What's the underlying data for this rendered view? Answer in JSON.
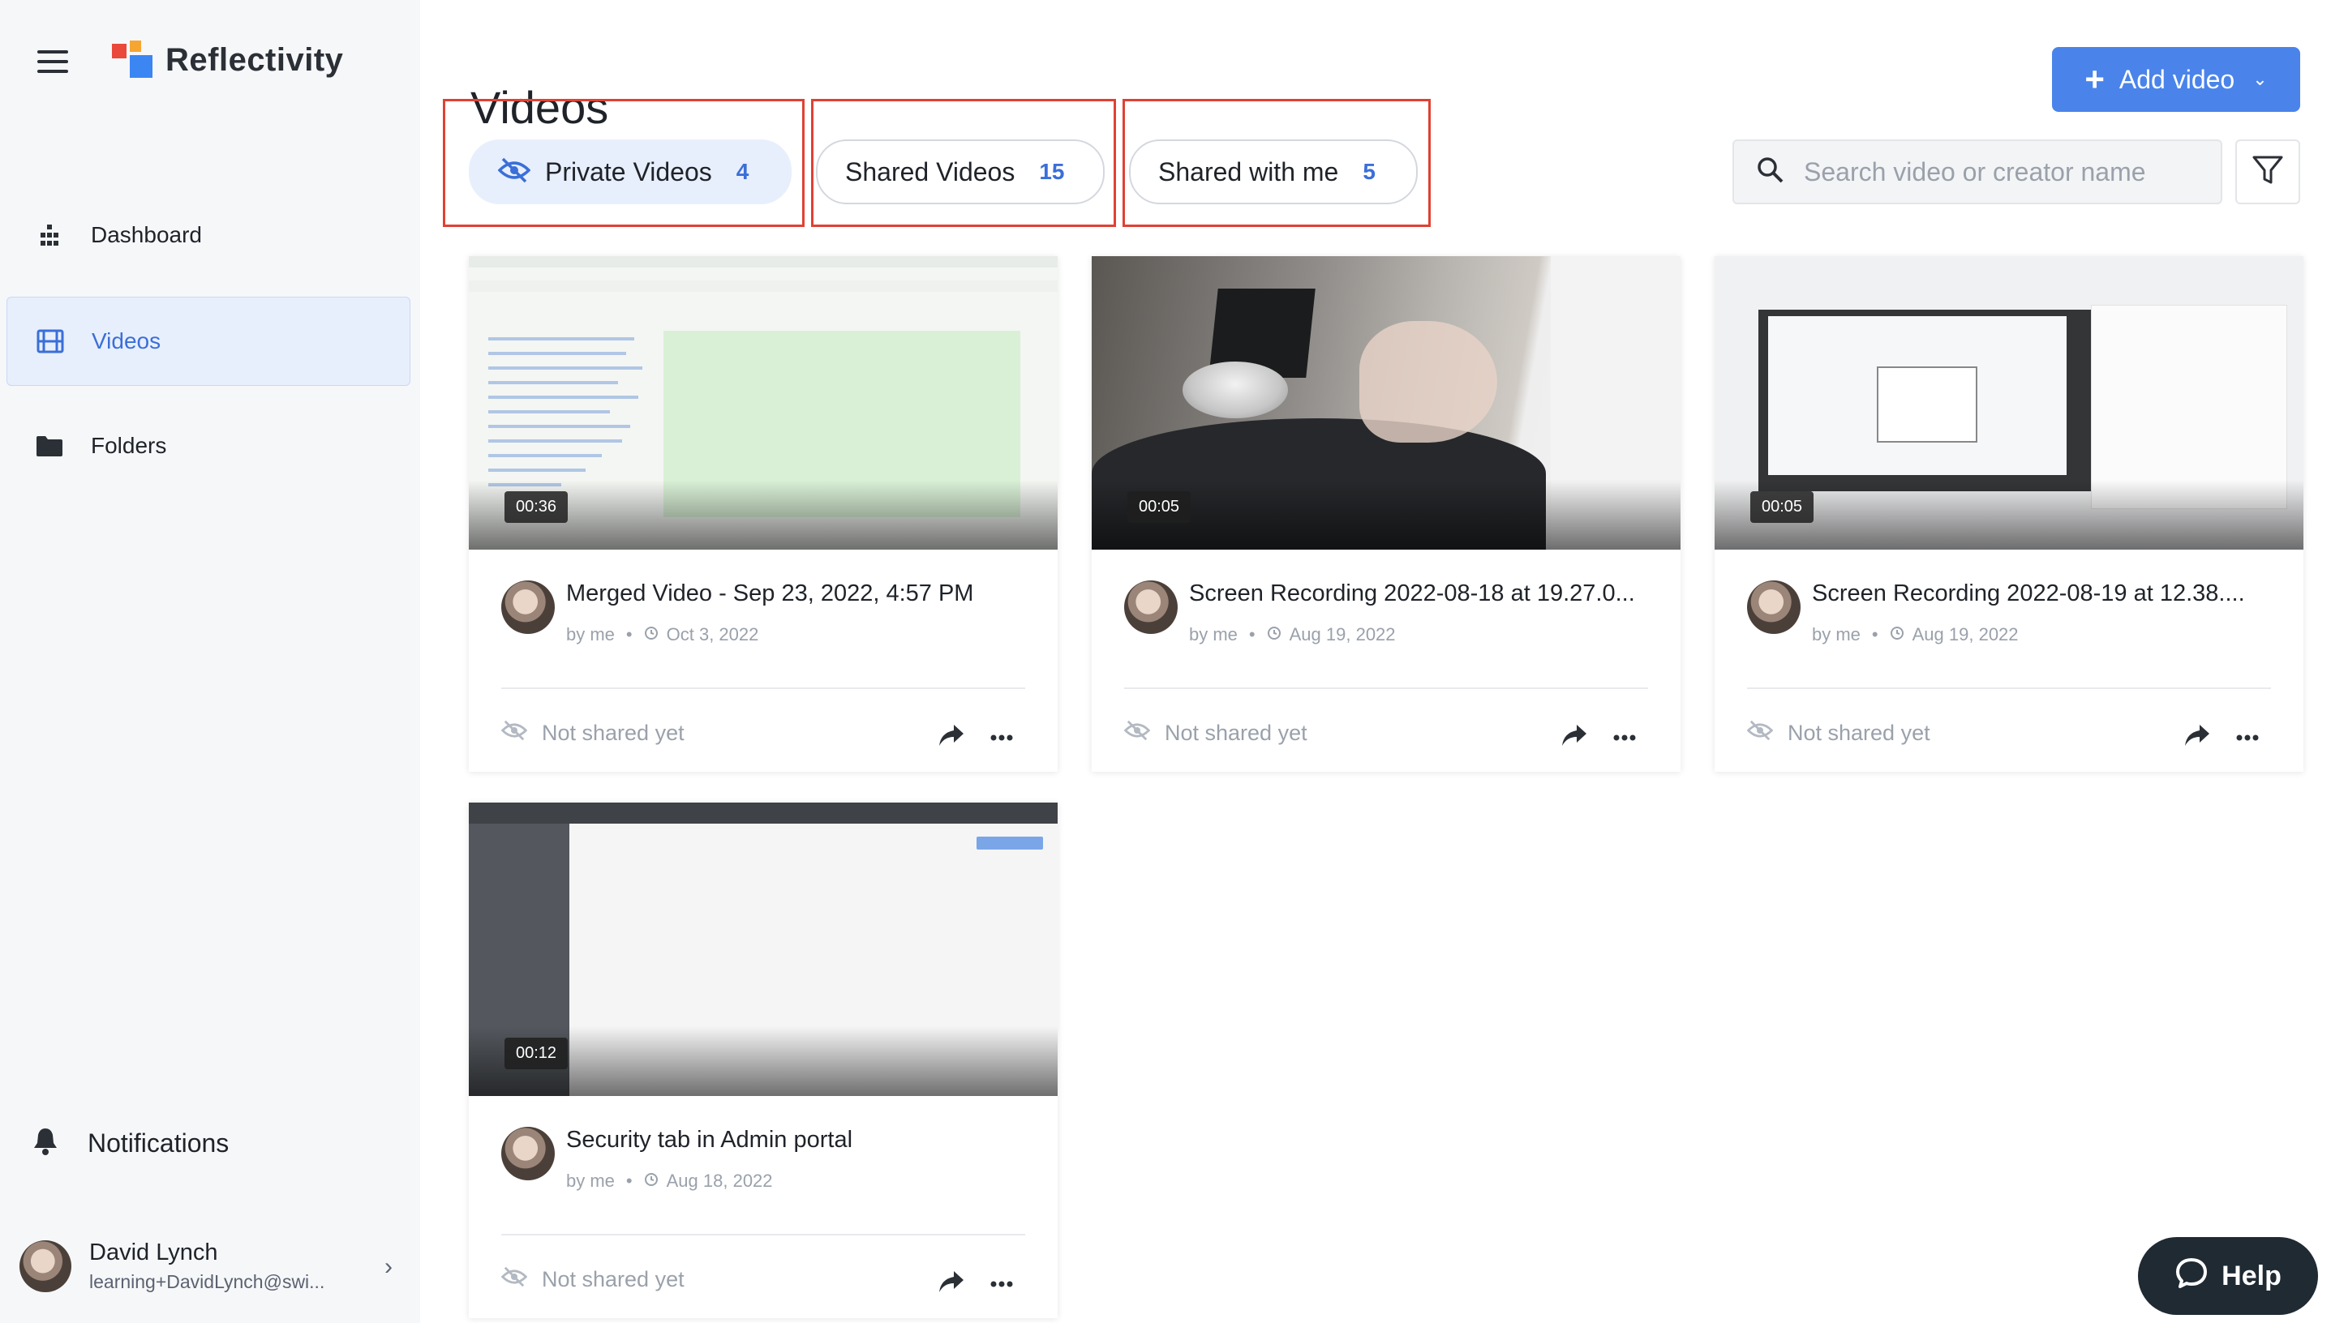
{
  "app": {
    "name": "Reflectivity"
  },
  "sidebar": {
    "items": [
      {
        "label": "Dashboard",
        "icon": "dashboard-icon"
      },
      {
        "label": "Videos",
        "icon": "film-icon",
        "active": true
      },
      {
        "label": "Folders",
        "icon": "folder-icon"
      }
    ],
    "notifications_label": "Notifications",
    "user": {
      "name": "David Lynch",
      "email": "learning+DavidLynch@swi..."
    }
  },
  "header": {
    "title": "Videos",
    "add_button_label": "Add video"
  },
  "tabs": [
    {
      "label": "Private Videos",
      "count": "4",
      "active": true
    },
    {
      "label": "Shared Videos",
      "count": "15",
      "active": false
    },
    {
      "label": "Shared with me",
      "count": "5",
      "active": false
    }
  ],
  "search": {
    "placeholder": "Search video or creator name",
    "value": ""
  },
  "videos": [
    {
      "title": "Merged Video - Sep 23, 2022, 4:57 PM",
      "duration": "00:36",
      "author": "by me",
      "date": "Oct 3, 2022",
      "share_status": "Not shared yet"
    },
    {
      "title": "Screen Recording 2022-08-18 at 19.27.0...",
      "duration": "00:05",
      "author": "by me",
      "date": "Aug 19, 2022",
      "share_status": "Not shared yet"
    },
    {
      "title": "Screen Recording 2022-08-19 at 12.38....",
      "duration": "00:05",
      "author": "by me",
      "date": "Aug 19, 2022",
      "share_status": "Not shared yet"
    },
    {
      "title": "Security tab in Admin portal",
      "duration": "00:12",
      "author": "by me",
      "date": "Aug 18, 2022",
      "share_status": "Not shared yet"
    }
  ],
  "help": {
    "label": "Help"
  },
  "colors": {
    "accent": "#4a84ea",
    "highlight": "#e04133",
    "active_bg": "#e8effc"
  }
}
